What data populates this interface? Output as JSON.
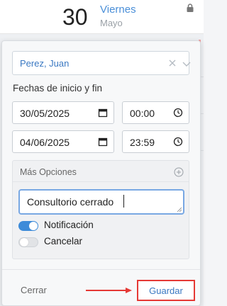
{
  "calendar": {
    "day_number": "30",
    "day_name": "Viernes",
    "month": "Mayo",
    "lock_icon": "lock-icon"
  },
  "event_form": {
    "user": {
      "value": "Perez, Juan",
      "clear_icon": "close-icon",
      "dropdown_icon": "chevron-down-icon"
    },
    "dates_label": "Fechas de inicio y fin",
    "start_date": "30/05/2025",
    "start_time": "00:00",
    "end_date": "04/06/2025",
    "end_time": "23:59",
    "calendar_icon": "calendar-icon",
    "clock_icon": "clock-icon",
    "more_options": {
      "title": "Más Opciones",
      "add_icon": "plus-circle-icon",
      "note_value": "Consultorio cerrado",
      "notification_label": "Notificación",
      "notification_on": true,
      "cancel_label": "Cancelar",
      "cancel_on": false
    },
    "footer": {
      "close_label": "Cerrar",
      "save_label": "Guardar"
    },
    "colors": {
      "accent": "#3d8bd9",
      "highlight": "#e53935"
    }
  }
}
